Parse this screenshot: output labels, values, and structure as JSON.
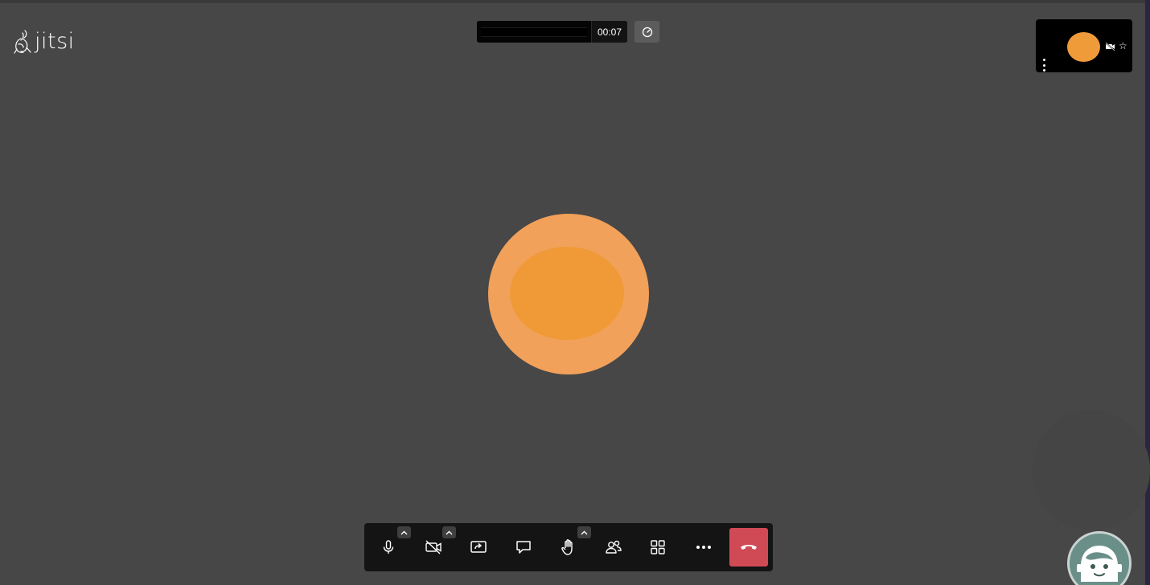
{
  "app": {
    "name": "jitsi",
    "logo_text": "jitsi"
  },
  "header": {
    "meeting_subject": "",
    "timer": "00:07"
  },
  "participant": {
    "avatar_color": "#ef9b3a",
    "large_avatar_outer_color": "#f2a15a",
    "large_avatar_inner_color": "#f09a37"
  },
  "thumbnail": {
    "video_muted": true,
    "moderator_star": "☆"
  },
  "toolbar": {
    "buttons": [
      {
        "id": "microphone",
        "icon": "microphone-icon",
        "has_options": true
      },
      {
        "id": "camera",
        "icon": "camera-off-icon",
        "has_options": true
      },
      {
        "id": "screenshare",
        "icon": "share-screen-icon",
        "has_options": false
      },
      {
        "id": "chat",
        "icon": "chat-icon",
        "has_options": false
      },
      {
        "id": "raise-hand",
        "icon": "hand-icon",
        "has_options": true
      },
      {
        "id": "participants",
        "icon": "participants-icon",
        "has_options": false
      },
      {
        "id": "tile-view",
        "icon": "tile-view-icon",
        "has_options": false
      },
      {
        "id": "more",
        "icon": "more-icon",
        "has_options": false
      },
      {
        "id": "hangup",
        "icon": "hangup-icon",
        "has_options": false
      }
    ],
    "hangup_color": "#d04a56"
  },
  "colors": {
    "background": "#474747",
    "toolbar": "#141414"
  }
}
